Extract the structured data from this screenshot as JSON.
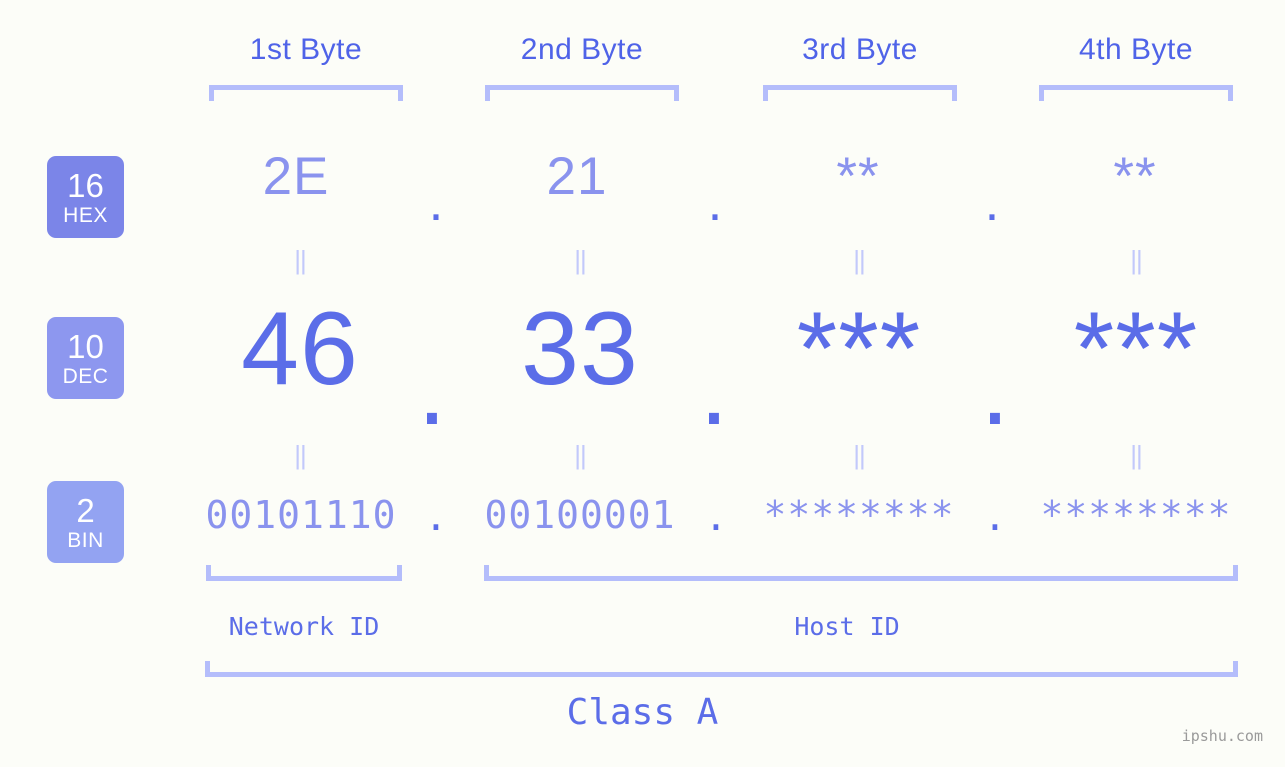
{
  "background_color": "#fcfdf8",
  "accent_color": "#5b6de8",
  "accent_light_color": "#8a93ee",
  "bracket_color": "#b4bdfb",
  "header": {
    "byte_labels": [
      "1st Byte",
      "2nd Byte",
      "3rd Byte",
      "4th Byte"
    ]
  },
  "bases": [
    {
      "number": "16",
      "name": "HEX",
      "badge_color": "#7b85e8",
      "values": [
        "2E",
        "21",
        "**",
        "**"
      ],
      "separator": "."
    },
    {
      "number": "10",
      "name": "DEC",
      "badge_color": "#8d97ef",
      "values": [
        "46",
        "33",
        "***",
        "***"
      ],
      "separator": "."
    },
    {
      "number": "2",
      "name": "BIN",
      "badge_color": "#93a3f2",
      "values": [
        "00101110",
        "00100001",
        "********",
        "********"
      ],
      "separator": "."
    }
  ],
  "equals_marks": {
    "symbol": "||",
    "count_per_row": 4,
    "rows": 2
  },
  "segments": {
    "network_id_label": "Network ID",
    "host_id_label": "Host ID",
    "class_label": "Class A"
  },
  "watermark": "ipshu.com"
}
